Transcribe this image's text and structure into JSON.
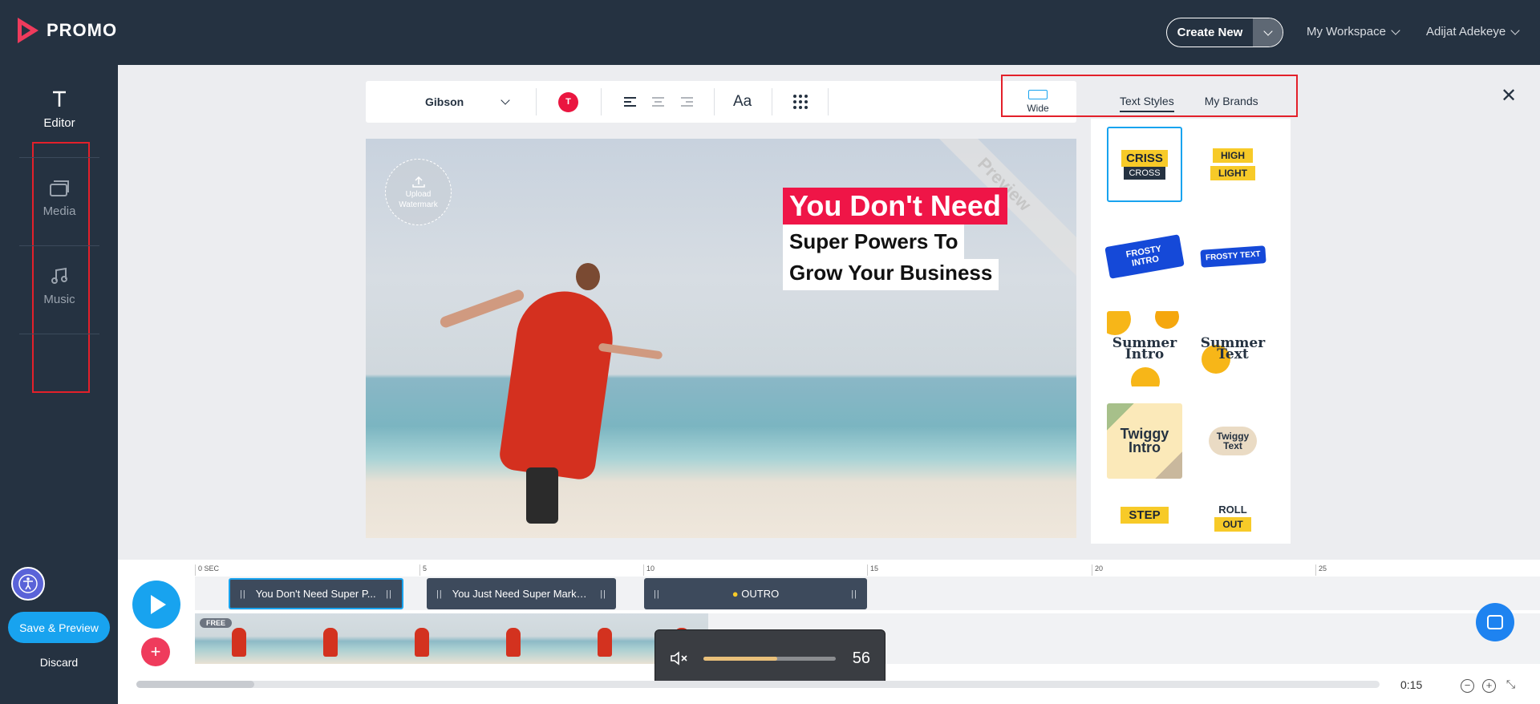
{
  "app": {
    "name": "PROMO"
  },
  "header": {
    "create_new": "Create New",
    "workspace": "My Workspace",
    "user": "Adijat Adekeye"
  },
  "sidebar": {
    "items": [
      {
        "label": "Editor",
        "icon": "text-icon",
        "active": true
      },
      {
        "label": "Media",
        "icon": "media-icon",
        "active": false
      },
      {
        "label": "Music",
        "icon": "music-icon",
        "active": false
      }
    ],
    "save": "Save & Preview",
    "discard": "Discard"
  },
  "toolbar": {
    "font": "Gibson",
    "color_label": "T",
    "text_size_label": "Aa",
    "aspect_label": "Wide"
  },
  "panel": {
    "tabs": [
      "Text Styles",
      "My Brands"
    ],
    "active_tab": "Text Styles",
    "styles": {
      "criss_top": "CRISS",
      "criss_bottom": "CROSS",
      "high": "HIGH",
      "light": "LIGHT",
      "frosty_intro": "FROSTY INTRO",
      "frosty_text": "FROSTY TEXT",
      "summer_intro_1": "Summer",
      "summer_intro_2": "Intro",
      "summer_text_1": "Summer",
      "summer_text_2": "Text",
      "twiggy_intro_1": "Twiggy",
      "twiggy_intro_2": "Intro",
      "twiggy_text_1": "Twiggy",
      "twiggy_text_2": "Text",
      "step": "STEP",
      "roll": "ROLL",
      "out": "OUT"
    }
  },
  "canvas": {
    "watermark_line1": "Upload",
    "watermark_line2": "Watermark",
    "preview_label": "Preview",
    "headline_1": "You Don't Need",
    "headline_2": "Super Powers To",
    "headline_3": "Grow Your Business"
  },
  "timeline": {
    "ruler": [
      "0 SEC",
      "5",
      "10",
      "15",
      "20",
      "25"
    ],
    "clips": [
      {
        "label": "You Don't Need Super P..."
      },
      {
        "label": "You Just Need Super Marke..."
      },
      {
        "label": "OUTRO"
      }
    ],
    "free_badge": "FREE",
    "volume": "56",
    "volume_fraction": 0.56,
    "time": "0:15",
    "accent": "#18a3ef",
    "brand": "#ef3b5c"
  }
}
